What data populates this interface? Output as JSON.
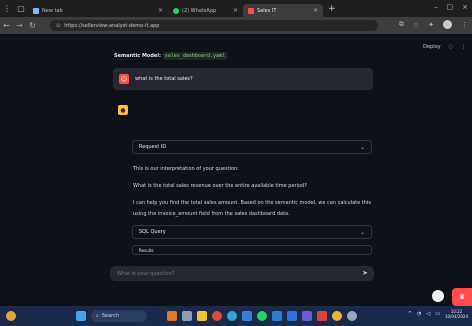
{
  "browser": {
    "tabs": [
      {
        "label": "New tab",
        "color": "#8ab4f8",
        "active": false
      },
      {
        "label": "(2) WhatsApp",
        "color": "#25d366",
        "active": false
      },
      {
        "label": "Sales IT",
        "color": "#ff4b4b",
        "active": true
      }
    ],
    "url": "https://sellerview-analyst-demo-it.app"
  },
  "app": {
    "deploy_label": "Deploy",
    "semantic_model_label": "Semantic Model:",
    "semantic_model_file": "sales_dashboard.yaml",
    "user_question": "what is the total sales?",
    "expander_request": "Request ID",
    "interpretation_intro": "This is our interpretation of your question:",
    "interpretation_question": "What is the total sales revenue over the entire available time period?",
    "answer_line1": "I can help you find the total sales amount. Based on the semantic model, we can calculate this",
    "answer_line2": "using the invoice_amount field from the sales dashboard data.",
    "expander_sql": "SQL Query",
    "expander_results": "Results",
    "chat_placeholder": "What is your question?"
  },
  "taskbar": {
    "search_label": "Search",
    "time": "10:22",
    "date": "10/04/2024"
  },
  "colors": {
    "accent": "#ff4b4b",
    "assistant_avatar": "#ffbd45",
    "background": "#0e1117"
  }
}
